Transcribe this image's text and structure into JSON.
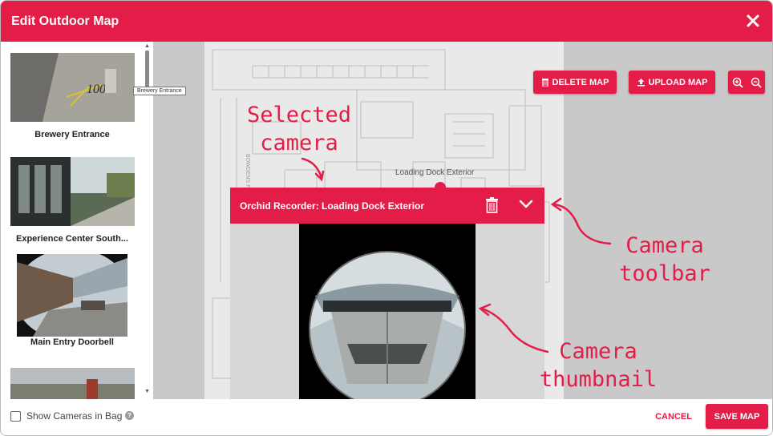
{
  "dialog": {
    "title": "Edit Outdoor Map",
    "close_icon": "close-icon"
  },
  "sidebar": {
    "cameras": [
      {
        "label": "Brewery Entrance"
      },
      {
        "label": "Experience Center South..."
      },
      {
        "label": "Main Entry Doorbell"
      },
      {
        "label": ""
      }
    ],
    "tooltip": "Brewery Entrance"
  },
  "map": {
    "delete_label": "DELETE MAP",
    "upload_label": "UPLOAD MAP",
    "zoom_in_icon": "zoom-in-icon",
    "zoom_out_icon": "zoom-out-icon",
    "marker_label": "Loading Dock Exterior",
    "street_label": "BOWDENS FERRY ROAD"
  },
  "camera_popup": {
    "name": "Orchid Recorder: Loading Dock Exterior",
    "delete_icon": "trash-icon",
    "collapse_icon": "chevron-down-icon"
  },
  "annotations": {
    "selected_camera": "Selected\ncamera",
    "camera_toolbar": "Camera\ntoolbar",
    "camera_thumbnail": "Camera\nthumbnail"
  },
  "footer": {
    "show_in_bag_label": "Show Cameras in Bag",
    "show_in_bag_checked": false,
    "cancel_label": "CANCEL",
    "save_label": "SAVE MAP"
  },
  "colors": {
    "accent": "#e31d48",
    "annotation": "#e31d48"
  }
}
